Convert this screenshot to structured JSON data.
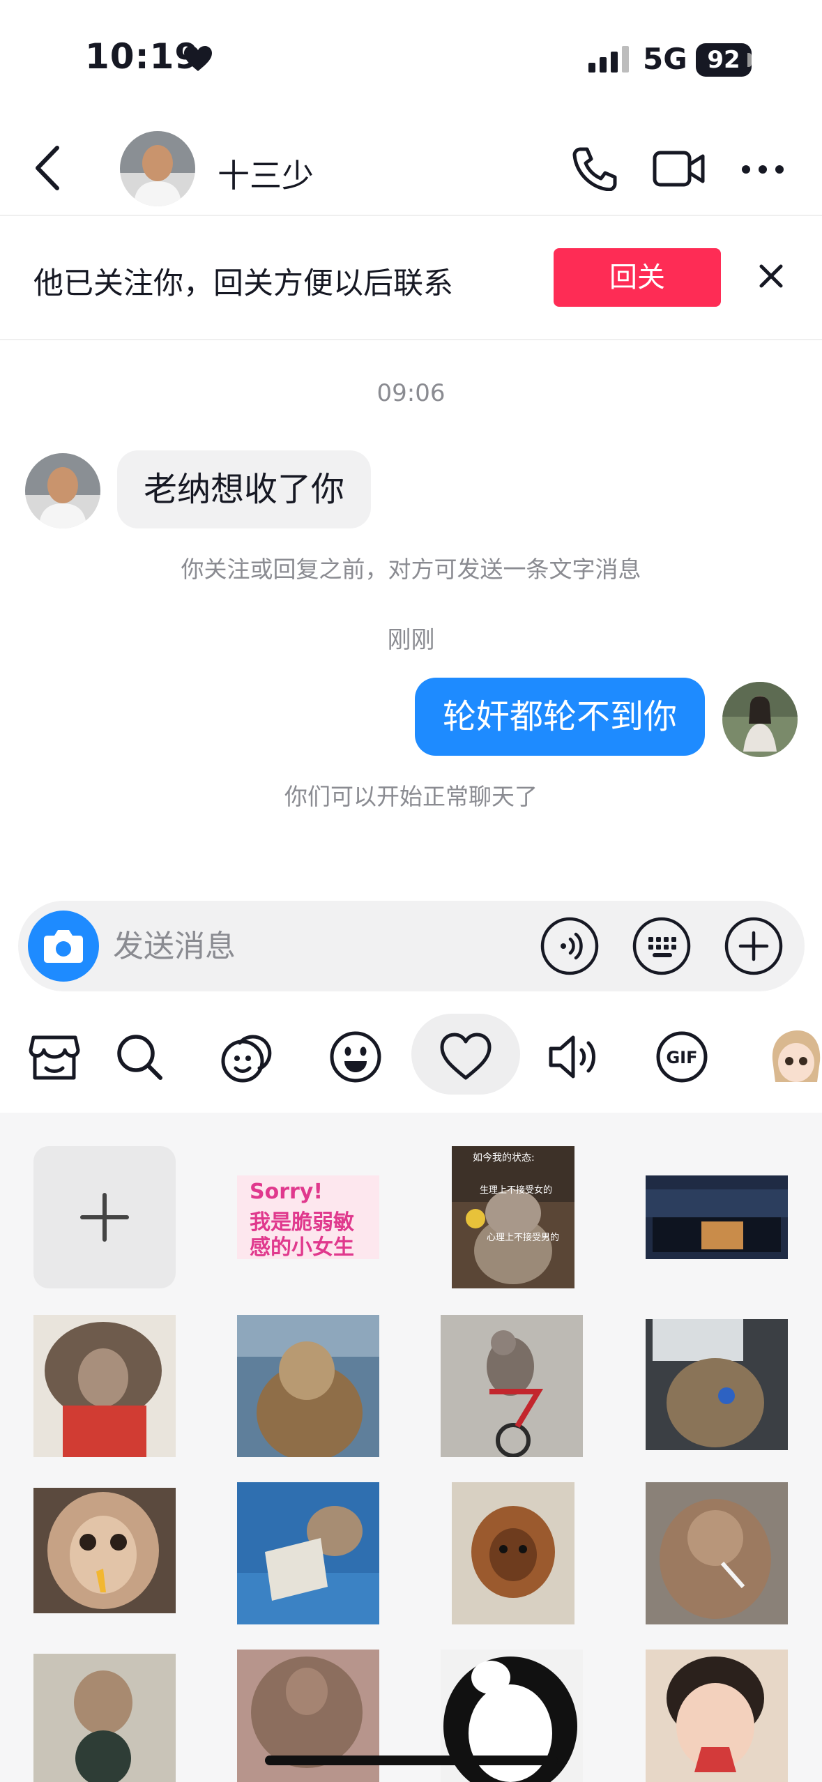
{
  "status_bar": {
    "time": "10:19",
    "network": "5G",
    "battery": "92"
  },
  "header": {
    "contact_name": "十三少"
  },
  "follow_banner": {
    "text": "他已关注你，回关方便以后联系",
    "button_label": "回关"
  },
  "chat": {
    "time_1": "09:06",
    "incoming_message": "老纳想收了你",
    "system_notice_1": "你关注或回复之前，对方可发送一条文字消息",
    "time_2": "刚刚",
    "outgoing_message": "轮奸都轮不到你",
    "system_notice_2": "你们可以开始正常聊天了"
  },
  "input_bar": {
    "placeholder": "发送消息"
  },
  "tool_tabs": [
    {
      "icon": "store-icon"
    },
    {
      "icon": "search-icon"
    },
    {
      "icon": "sticker-face-icon"
    },
    {
      "icon": "emoji-icon"
    },
    {
      "icon": "heart-icon",
      "active": true
    },
    {
      "icon": "voice-icon"
    },
    {
      "icon": "gif-icon"
    },
    {
      "icon": "avatar-sticker-icon"
    }
  ],
  "stickers": {
    "sorry_line1": "Sorry!",
    "sorry_line2": "我是脆弱敏",
    "sorry_line3": "感的小女生",
    "cat_line1": "如今我的状态:",
    "cat_line2": "生理上不接受女的",
    "cat_line3": "心理上不接受男的"
  },
  "colors": {
    "accent_red": "#fe2c55",
    "accent_blue": "#1e8bff"
  }
}
